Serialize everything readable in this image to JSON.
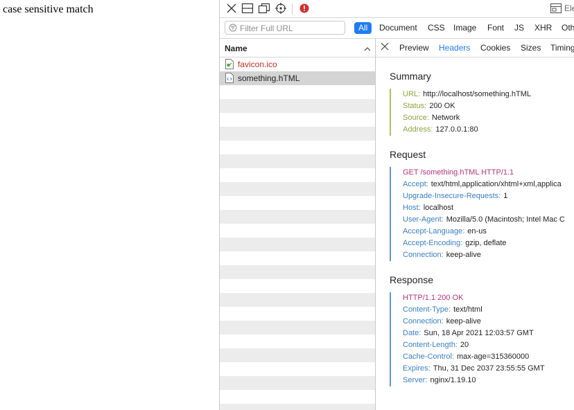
{
  "page": {
    "text": "case sensitive match"
  },
  "toolbar": {
    "right_label": "Ele"
  },
  "filter": {
    "placeholder": "Filter Full URL",
    "types": [
      "All",
      "Document",
      "CSS",
      "Image",
      "Font",
      "JS",
      "XHR",
      "Oth"
    ],
    "active_type": "All"
  },
  "name_column": {
    "header": "Name",
    "rows": [
      {
        "name": "favicon.ico",
        "color": "#d02b22"
      },
      {
        "name": "something.hTML",
        "color": "#222222"
      }
    ]
  },
  "details": {
    "tabs": [
      "Preview",
      "Headers",
      "Cookies",
      "Sizes",
      "Timing"
    ],
    "active_tab": "Headers",
    "summary": {
      "title": "Summary",
      "items": [
        {
          "key": "URL:",
          "value": "http://localhost/something.hTML"
        },
        {
          "key": "Status:",
          "value": "200 OK"
        },
        {
          "key": "Source:",
          "value": "Network"
        },
        {
          "key": "Address:",
          "value": "127.0.0.1:80"
        }
      ]
    },
    "request": {
      "title": "Request",
      "first_line": "GET /something.hTML HTTP/1.1",
      "items": [
        {
          "key": "Accept:",
          "value": "text/html,application/xhtml+xml,applica"
        },
        {
          "key": "Upgrade-Insecure-Requests:",
          "value": "1"
        },
        {
          "key": "Host:",
          "value": "localhost"
        },
        {
          "key": "User-Agent:",
          "value": "Mozilla/5.0 (Macintosh; Intel Mac C"
        },
        {
          "key": "Accept-Language:",
          "value": "en-us"
        },
        {
          "key": "Accept-Encoding:",
          "value": "gzip, deflate"
        },
        {
          "key": "Connection:",
          "value": "keep-alive"
        }
      ]
    },
    "response": {
      "title": "Response",
      "first_line": "HTTP/1.1 200 OK",
      "items": [
        {
          "key": "Content-Type:",
          "value": "text/html"
        },
        {
          "key": "Connection:",
          "value": "keep-alive"
        },
        {
          "key": "Date:",
          "value": "Sun, 18 Apr 2021 12:03:57 GMT"
        },
        {
          "key": "Content-Length:",
          "value": "20"
        },
        {
          "key": "Cache-Control:",
          "value": "max-age=315360000"
        },
        {
          "key": "Expires:",
          "value": "Thu, 31 Dec 2037 23:55:55 GMT"
        },
        {
          "key": "Server:",
          "value": "nginx/1.19.10"
        }
      ]
    }
  },
  "colors": {
    "accent": "#1f7cf5",
    "summary_key": "#8aa53b",
    "summary_border": "#a9c25d",
    "request_key": "#3a7fc4",
    "request_border": "#5b96d3",
    "first_line": "#b4337a",
    "error_icon": "#d0302f"
  }
}
